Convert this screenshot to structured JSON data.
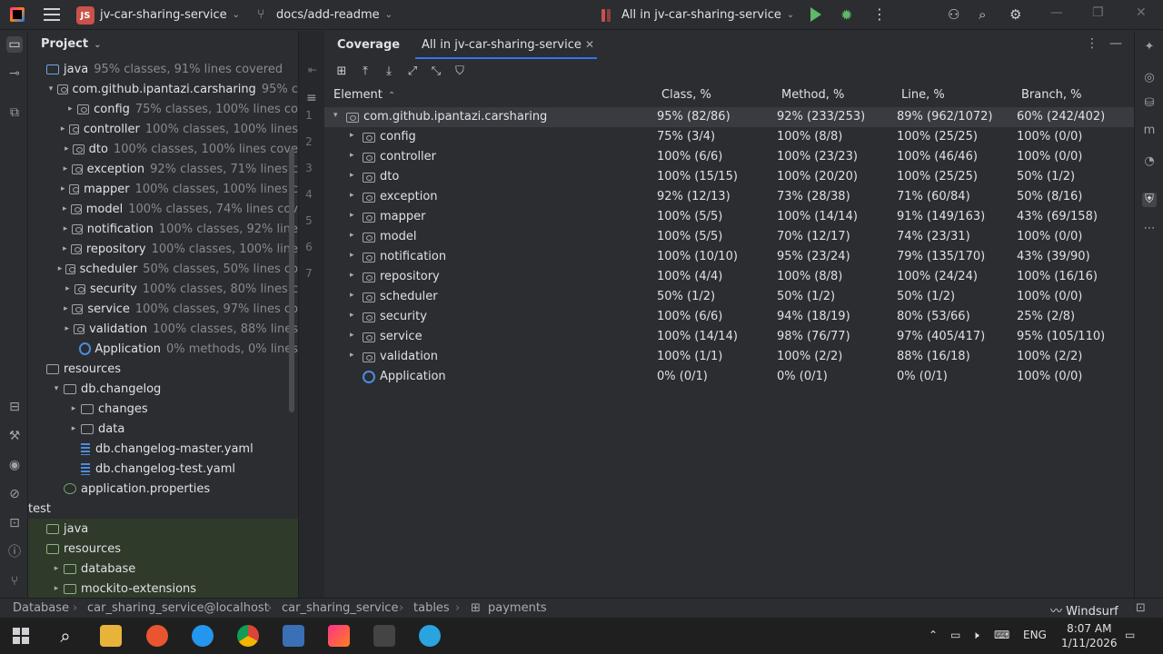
{
  "titlebar": {
    "project_badge": "JS",
    "project_name": "jv-car-sharing-service",
    "branch": "docs/add-readme",
    "run_config": "All in jv-car-sharing-service"
  },
  "project_panel": {
    "title": "Project",
    "rows": [
      {
        "indent": 0,
        "arrow": "",
        "icon": "folder-blue",
        "name": "java",
        "stat": "95% classes, 91% lines covered"
      },
      {
        "indent": 1,
        "arrow": "v",
        "icon": "package",
        "name": "com.github.ipantazi.carsharing",
        "stat": "95% c"
      },
      {
        "indent": 2,
        "arrow": ">",
        "icon": "package",
        "name": "config",
        "stat": "75% classes, 100% lines co"
      },
      {
        "indent": 2,
        "arrow": ">",
        "icon": "package",
        "name": "controller",
        "stat": "100% classes, 100% lines"
      },
      {
        "indent": 2,
        "arrow": ">",
        "icon": "package",
        "name": "dto",
        "stat": "100% classes, 100% lines cove"
      },
      {
        "indent": 2,
        "arrow": ">",
        "icon": "package",
        "name": "exception",
        "stat": "92% classes, 71% lines c"
      },
      {
        "indent": 2,
        "arrow": ">",
        "icon": "package",
        "name": "mapper",
        "stat": "100% classes, 100% lines c"
      },
      {
        "indent": 2,
        "arrow": ">",
        "icon": "package",
        "name": "model",
        "stat": "100% classes, 74% lines cov"
      },
      {
        "indent": 2,
        "arrow": ">",
        "icon": "package",
        "name": "notification",
        "stat": "100% classes, 92% line"
      },
      {
        "indent": 2,
        "arrow": ">",
        "icon": "package",
        "name": "repository",
        "stat": "100% classes, 100% line"
      },
      {
        "indent": 2,
        "arrow": ">",
        "icon": "package",
        "name": "scheduler",
        "stat": "50% classes, 50% lines co"
      },
      {
        "indent": 2,
        "arrow": ">",
        "icon": "package",
        "name": "security",
        "stat": "100% classes, 80% lines c"
      },
      {
        "indent": 2,
        "arrow": ">",
        "icon": "package",
        "name": "service",
        "stat": "100% classes, 97% lines co"
      },
      {
        "indent": 2,
        "arrow": ">",
        "icon": "package",
        "name": "validation",
        "stat": "100% classes, 88% lines"
      },
      {
        "indent": 2,
        "arrow": "",
        "icon": "class",
        "name": "Application",
        "stat": "0% methods, 0% lines"
      },
      {
        "indent": 0,
        "arrow": "",
        "icon": "folder",
        "name": "resources",
        "stat": ""
      },
      {
        "indent": 1,
        "arrow": "v",
        "icon": "folder",
        "name": "db.changelog",
        "stat": ""
      },
      {
        "indent": 2,
        "arrow": ">",
        "icon": "folder",
        "name": "changes",
        "stat": ""
      },
      {
        "indent": 2,
        "arrow": ">",
        "icon": "folder",
        "name": "data",
        "stat": ""
      },
      {
        "indent": 2,
        "arrow": "",
        "icon": "yaml",
        "name": "db.changelog-master.yaml",
        "stat": ""
      },
      {
        "indent": 2,
        "arrow": "",
        "icon": "yaml",
        "name": "db.changelog-test.yaml",
        "stat": ""
      },
      {
        "indent": 1,
        "arrow": "",
        "icon": "properties",
        "name": "application.properties",
        "stat": ""
      },
      {
        "indent": -1,
        "arrow": "",
        "icon": "none",
        "name": "test",
        "stat": ""
      },
      {
        "indent": 0,
        "arrow": "",
        "icon": "folder-green",
        "name": "java",
        "stat": ""
      },
      {
        "indent": 0,
        "arrow": "",
        "icon": "folder-green",
        "name": "resources",
        "stat": ""
      },
      {
        "indent": 1,
        "arrow": ">",
        "icon": "folder-green",
        "name": "database",
        "stat": ""
      },
      {
        "indent": 1,
        "arrow": ">",
        "icon": "folder-green",
        "name": "mockito-extensions",
        "stat": ""
      }
    ],
    "line_numbers": [
      "1",
      "2",
      "3",
      "4",
      "5",
      "6",
      "7"
    ]
  },
  "coverage": {
    "title": "Coverage",
    "tab": "All in jv-car-sharing-service",
    "columns": [
      "Element",
      "Class, %",
      "Method, %",
      "Line, %",
      "Branch, %"
    ],
    "rows": [
      {
        "level": 0,
        "arrow": "v",
        "icon": "package",
        "name": "com.github.ipantazi.carsharing",
        "class": "95% (82/86)",
        "method": "92% (233/253)",
        "line": "89% (962/1072)",
        "branch": "60% (242/402)"
      },
      {
        "level": 1,
        "arrow": ">",
        "icon": "package",
        "name": "config",
        "class": "75% (3/4)",
        "method": "100% (8/8)",
        "line": "100% (25/25)",
        "branch": "100% (0/0)"
      },
      {
        "level": 1,
        "arrow": ">",
        "icon": "package",
        "name": "controller",
        "class": "100% (6/6)",
        "method": "100% (23/23)",
        "line": "100% (46/46)",
        "branch": "100% (0/0)"
      },
      {
        "level": 1,
        "arrow": ">",
        "icon": "package",
        "name": "dto",
        "class": "100% (15/15)",
        "method": "100% (20/20)",
        "line": "100% (25/25)",
        "branch": "50% (1/2)"
      },
      {
        "level": 1,
        "arrow": ">",
        "icon": "package",
        "name": "exception",
        "class": "92% (12/13)",
        "method": "73% (28/38)",
        "line": "71% (60/84)",
        "branch": "50% (8/16)"
      },
      {
        "level": 1,
        "arrow": ">",
        "icon": "package",
        "name": "mapper",
        "class": "100% (5/5)",
        "method": "100% (14/14)",
        "line": "91% (149/163)",
        "branch": "43% (69/158)"
      },
      {
        "level": 1,
        "arrow": ">",
        "icon": "package",
        "name": "model",
        "class": "100% (5/5)",
        "method": "70% (12/17)",
        "line": "74% (23/31)",
        "branch": "100% (0/0)"
      },
      {
        "level": 1,
        "arrow": ">",
        "icon": "package",
        "name": "notification",
        "class": "100% (10/10)",
        "method": "95% (23/24)",
        "line": "79% (135/170)",
        "branch": "43% (39/90)"
      },
      {
        "level": 1,
        "arrow": ">",
        "icon": "package",
        "name": "repository",
        "class": "100% (4/4)",
        "method": "100% (8/8)",
        "line": "100% (24/24)",
        "branch": "100% (16/16)"
      },
      {
        "level": 1,
        "arrow": ">",
        "icon": "package",
        "name": "scheduler",
        "class": "50% (1/2)",
        "method": "50% (1/2)",
        "line": "50% (1/2)",
        "branch": "100% (0/0)"
      },
      {
        "level": 1,
        "arrow": ">",
        "icon": "package",
        "name": "security",
        "class": "100% (6/6)",
        "method": "94% (18/19)",
        "line": "80% (53/66)",
        "branch": "25% (2/8)"
      },
      {
        "level": 1,
        "arrow": ">",
        "icon": "package",
        "name": "service",
        "class": "100% (14/14)",
        "method": "98% (76/77)",
        "line": "97% (405/417)",
        "branch": "95% (105/110)"
      },
      {
        "level": 1,
        "arrow": ">",
        "icon": "package",
        "name": "validation",
        "class": "100% (1/1)",
        "method": "100% (2/2)",
        "line": "88% (16/18)",
        "branch": "100% (2/2)"
      },
      {
        "level": 1,
        "arrow": "",
        "icon": "class",
        "name": "Application",
        "class": "0% (0/1)",
        "method": "0% (0/1)",
        "line": "0% (0/1)",
        "branch": "100% (0/0)"
      }
    ]
  },
  "statusbar": {
    "crumbs": [
      "Database",
      "car_sharing_service@localhost",
      "car_sharing_service",
      "tables",
      "payments"
    ],
    "plugin": "Windsurf"
  },
  "taskbar": {
    "lang": "ENG",
    "time": "8:07 AM",
    "date": "1/11/2026"
  },
  "colors": {
    "accent": "#3574f0",
    "run_green": "#5fb865",
    "badge_red": "#c9524a"
  }
}
